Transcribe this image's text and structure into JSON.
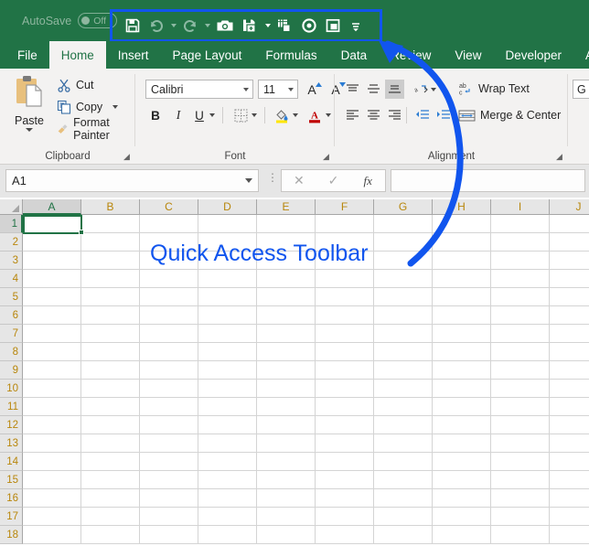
{
  "titlebar": {
    "autosave_label": "AutoSave",
    "autosave_state": "Off"
  },
  "quick_access_toolbar": {
    "highlight_color": "#1155ee",
    "buttons": [
      {
        "name": "save-icon",
        "label": "Save",
        "has_caret": false
      },
      {
        "name": "undo-icon",
        "label": "Undo",
        "has_caret": true
      },
      {
        "name": "redo-icon",
        "label": "Redo",
        "has_caret": true
      },
      {
        "name": "camera-icon",
        "label": "Camera",
        "has_caret": false
      },
      {
        "name": "save-as-icon",
        "label": "Save As",
        "has_caret": true
      },
      {
        "name": "copy-picture-icon",
        "label": "Copy as Picture",
        "has_caret": false
      },
      {
        "name": "record-macro-icon",
        "label": "Record Macro",
        "has_caret": false
      },
      {
        "name": "freeze-panes-icon",
        "label": "Freeze Panes",
        "has_caret": false
      },
      {
        "name": "customize-qat-icon",
        "label": "Customize Quick Access Toolbar",
        "has_caret": false
      }
    ]
  },
  "ribbon_tabs": [
    {
      "label": "File",
      "active": false
    },
    {
      "label": "Home",
      "active": true
    },
    {
      "label": "Insert",
      "active": false
    },
    {
      "label": "Page Layout",
      "active": false
    },
    {
      "label": "Formulas",
      "active": false
    },
    {
      "label": "Data",
      "active": false
    },
    {
      "label": "Review",
      "active": false
    },
    {
      "label": "View",
      "active": false
    },
    {
      "label": "Developer",
      "active": false
    },
    {
      "label": "Add-",
      "active": false
    }
  ],
  "ribbon": {
    "clipboard": {
      "group_label": "Clipboard",
      "paste_label": "Paste",
      "cut_label": "Cut",
      "copy_label": "Copy",
      "format_painter_label": "Format Painter"
    },
    "font": {
      "group_label": "Font",
      "font_name": "Calibri",
      "font_size": "11",
      "grow_font_label": "A",
      "shrink_font_label": "A",
      "bold_label": "B",
      "italic_label": "I",
      "underline_label": "U"
    },
    "alignment": {
      "group_label": "Alignment",
      "wrap_text_label": "Wrap Text",
      "merge_center_label": "Merge & Center"
    },
    "number": {
      "format_value": "G"
    }
  },
  "formula_bar": {
    "name_box_value": "A1",
    "cancel_label": "✕",
    "enter_label": "✓",
    "function_label": "fx",
    "formula_value": ""
  },
  "grid": {
    "columns": [
      "A",
      "B",
      "C",
      "D",
      "E",
      "F",
      "G",
      "H",
      "I",
      "J"
    ],
    "rows": [
      "1",
      "2",
      "3",
      "4",
      "5",
      "6",
      "7",
      "8",
      "9",
      "10",
      "11",
      "12",
      "13",
      "14",
      "15",
      "16",
      "17",
      "18"
    ],
    "selected_cell": "A1"
  },
  "annotation": {
    "text": "Quick Access Toolbar",
    "color": "#1155ee"
  }
}
